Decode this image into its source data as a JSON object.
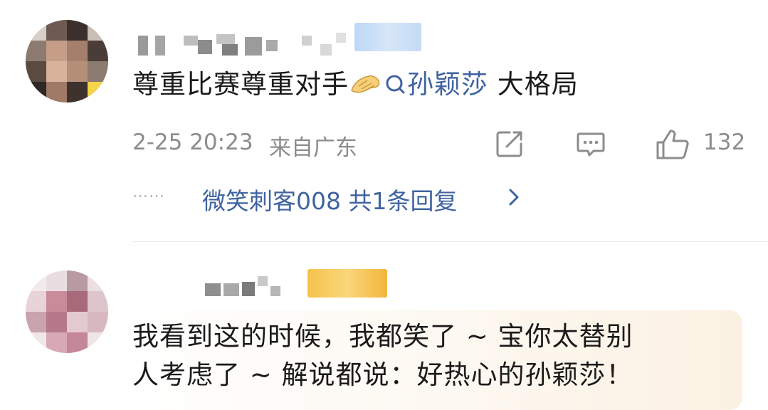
{
  "comments": [
    {
      "username": "",
      "text_part1": "尊重比赛尊重对手",
      "topic": "孙颖莎",
      "text_part2": " 大格局",
      "time": "2-25 20:23",
      "location": "来自广东",
      "like_count": "132",
      "reply_dots": "……",
      "reply_summary": "微笑刺客008  共1条回复"
    },
    {
      "username": "",
      "text_line1": "我看到这的时候，我都笑了 ~ 宝你太替别",
      "text_line2": "人考虑了 ~ 解说都说：好热心的孙颖莎！"
    }
  ],
  "icons": {
    "share": "share-icon",
    "comment": "comment-icon",
    "like": "thumbs-up-icon",
    "topic": "search-topic-icon",
    "emoji": "pinched-fingers-emoji",
    "chevron": "chevron-right-icon"
  },
  "colors": {
    "link": "#3f63a0",
    "meta": "#8c8c8c",
    "text": "#1a1a1a",
    "vip_blue": "#c3dbf6",
    "vip_gold": "#f6c24c"
  }
}
